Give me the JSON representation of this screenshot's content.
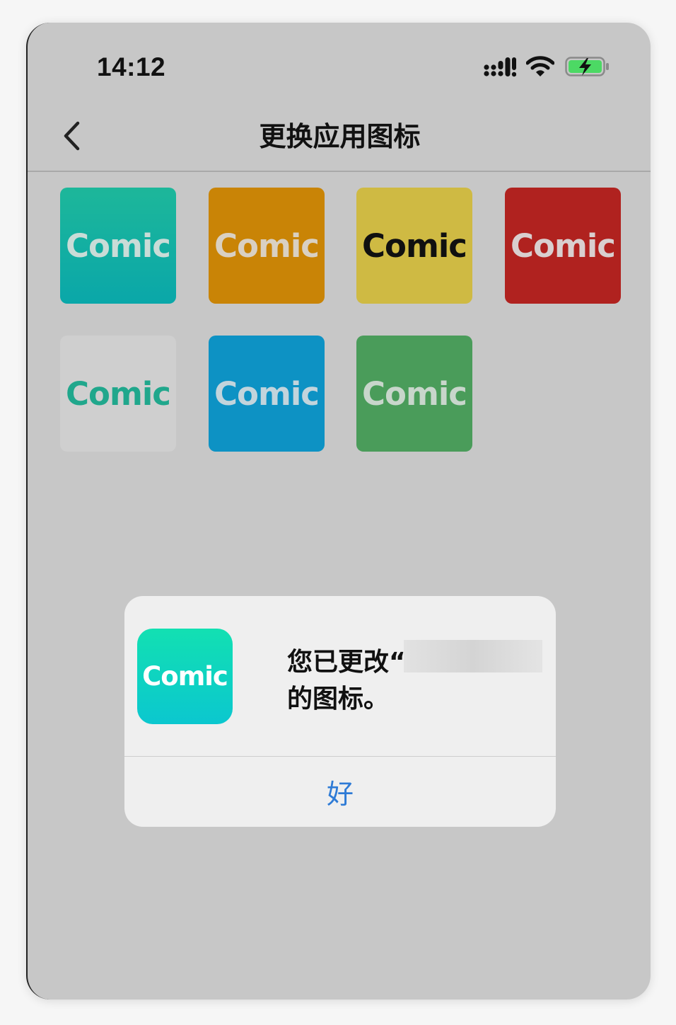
{
  "status_bar": {
    "time": "14:12",
    "icons": [
      "cellular-signal-icon",
      "wifi-icon",
      "battery-charging-icon"
    ],
    "battery_color": "#4cd964"
  },
  "nav": {
    "back_icon": "chevron-left-icon",
    "title": "更换应用图标"
  },
  "icon_options": [
    {
      "label": "Comic",
      "color": "teal",
      "bg": "#0fb0a2"
    },
    {
      "label": "Comic",
      "color": "orange",
      "bg": "#c98406"
    },
    {
      "label": "Comic",
      "color": "yellow",
      "bg": "#cfba43"
    },
    {
      "label": "Comic",
      "color": "red",
      "bg": "#b0221f"
    },
    {
      "label": "Comic",
      "color": "light-gray",
      "bg": "#cfcfcf"
    },
    {
      "label": "Comic",
      "color": "blue",
      "bg": "#0d92c4"
    },
    {
      "label": "Comic",
      "color": "green",
      "bg": "#4a9c5a"
    }
  ],
  "alert": {
    "app_icon_label": "Comic",
    "message_line1": "您已更改“",
    "message_line2": "的图标。",
    "ok_label": "好",
    "ok_color": "#2e7bd6"
  }
}
